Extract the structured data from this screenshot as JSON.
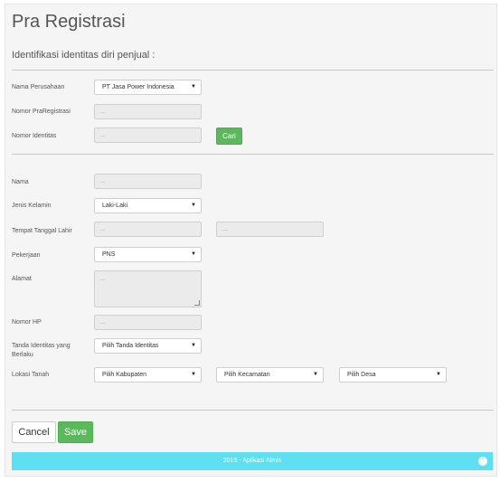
{
  "header": {
    "title": "Pra Registrasi",
    "section_title": "Identifikasi identitas diri penjual :"
  },
  "form": {
    "nama_perusahaan": {
      "label": "Nama Perusahaan",
      "value": "PT Jasa Power Indonesia"
    },
    "nomor_praregistrasi": {
      "label": "Nomor PraRegistrasi",
      "placeholder": "..."
    },
    "nomor_identitas": {
      "label": "Nomor Identitas",
      "placeholder": "..."
    },
    "cari_label": "Cari",
    "nama": {
      "label": "Nama",
      "placeholder": "..."
    },
    "jenis_kelamin": {
      "label": "Jenis Kelamin",
      "value": "Laki-Laki"
    },
    "tempat_tanggal_lahir": {
      "label": "Tempat Tanggal Lahir",
      "tempat_placeholder": "...",
      "tanggal_placeholder": "..."
    },
    "pekerjaan": {
      "label": "Pekerjaan",
      "value": "PNS"
    },
    "alamat": {
      "label": "Alamat",
      "placeholder": "..."
    },
    "nomor_hp": {
      "label": "Nomor HP",
      "placeholder": "..."
    },
    "tanda_identitas": {
      "label": "Tanda Identitas yang Berlaku",
      "value": "Pilih Tanda Identitas"
    },
    "lokasi_tanah": {
      "label": "Lokasi Tanah",
      "kabupaten": "Pilih Kabupaten",
      "kecamatan": "Pilih Kecamatan",
      "desa": "Pilih Desa"
    }
  },
  "actions": {
    "cancel_label": "Cancel",
    "save_label": "Save"
  },
  "footer": {
    "text": "2015 - Aplikasi Almis",
    "scroll_top_icon": "chevron-up-icon"
  },
  "icons": {
    "dropdown_caret": "▼",
    "chevron_up": "⌃"
  },
  "colors": {
    "primary_green": "#5cb85c",
    "footer_cyan": "#5ee0f2"
  }
}
